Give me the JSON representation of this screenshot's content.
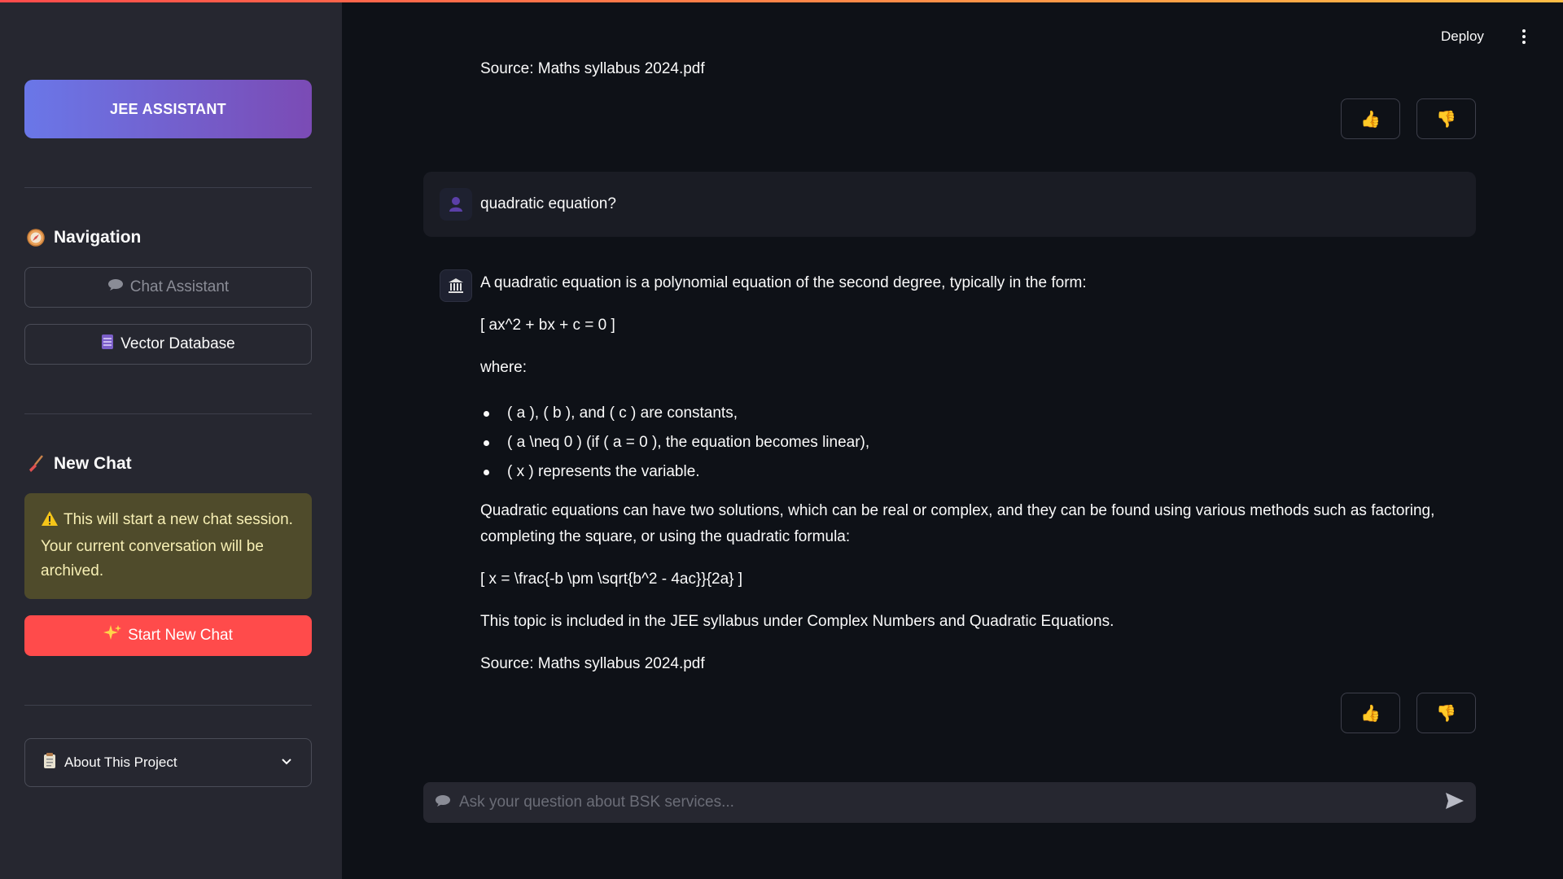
{
  "app": {
    "deploy_label": "Deploy"
  },
  "sidebar": {
    "brand": "JEE ASSISTANT",
    "navigation_title": "Navigation",
    "nav_items": [
      {
        "label": "Chat Assistant",
        "state": "disabled",
        "icon": "speech-bubble-icon"
      },
      {
        "label": "Vector Database",
        "state": "active",
        "icon": "database-icon"
      }
    ],
    "new_chat_title": "New Chat",
    "warning_text": "This will start a new chat session. Your current conversation will be archived.",
    "start_button": "Start New Chat",
    "about_label": "About This Project"
  },
  "chat": {
    "prev_source": "Source: Maths syllabus 2024.pdf",
    "user_message": "quadratic equation?",
    "answer": {
      "intro": "A quadratic equation is a polynomial equation of the second degree, typically in the form:",
      "formula1": "[ ax^2 + bx + c = 0 ]",
      "where": "where:",
      "bullets": [
        "( a ), ( b ), and ( c ) are constants,",
        "( a \\neq 0 ) (if ( a = 0 ), the equation becomes linear),",
        "( x ) represents the variable."
      ],
      "para": "Quadratic equations can have two solutions, which can be real or complex, and they can be found using various methods such as factoring, completing the square, or using the quadratic formula:",
      "formula2": "[ x = \\frac{-b \\pm \\sqrt{b^2 - 4ac}}{2a} ]",
      "syllabus_note": "This topic is included in the JEE syllabus under Complex Numbers and Quadratic Equations.",
      "source": "Source: Maths syllabus 2024.pdf"
    },
    "input_placeholder": "Ask your question about BSK services..."
  },
  "colors": {
    "background": "#0e1117",
    "sidebar": "#262730",
    "brand_gradient_start": "#6a77e8",
    "brand_gradient_end": "#7b4bb5",
    "primary_red": "#ff4b4b",
    "warning_bg": "#4f4b2b"
  }
}
